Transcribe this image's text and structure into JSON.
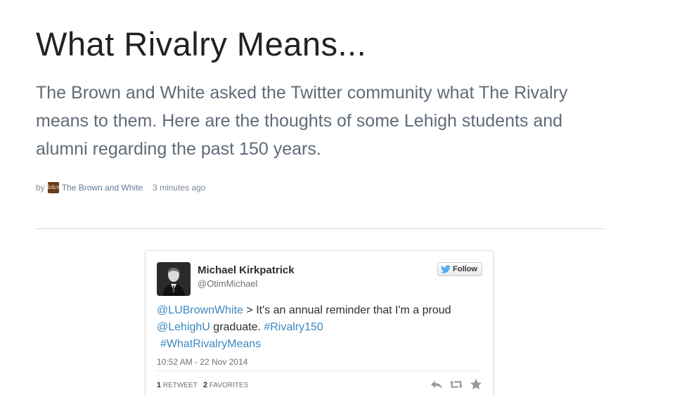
{
  "article": {
    "title": "What Rivalry Means...",
    "summary": "The Brown and White asked the Twitter community what The Rivalry means to them. Here are the thoughts of some Lehigh students and alumni regarding the past 150 years.",
    "byline": {
      "by_label": "by",
      "author_logo_text": "b&w",
      "author_name": "The Brown and White",
      "time_ago": "3 minutes ago"
    }
  },
  "tweet": {
    "author_name": "Michael Kirkpatrick",
    "author_handle": "@OtimMichael",
    "follow_label": "Follow",
    "text_parts": {
      "mention1": "@LUBrownWhite",
      "text1": " > It's an annual reminder that I'm a proud ",
      "mention2": "@LehighU",
      "text2": " graduate. ",
      "hashtag1": "#Rivalry150",
      "hashtag2": "#WhatRivalryMeans"
    },
    "date": "10:52 AM - 22 Nov 2014",
    "retweets_count": "1",
    "retweets_label": "Retweet",
    "favorites_count": "2",
    "favorites_label": "Favorites"
  },
  "colors": {
    "link": "#3b88c3",
    "summary_text": "#5f6b78",
    "twitter_bird": "#55acee"
  },
  "icons": [
    "twitter-bird-icon",
    "reply-icon",
    "retweet-icon",
    "favorite-icon"
  ]
}
